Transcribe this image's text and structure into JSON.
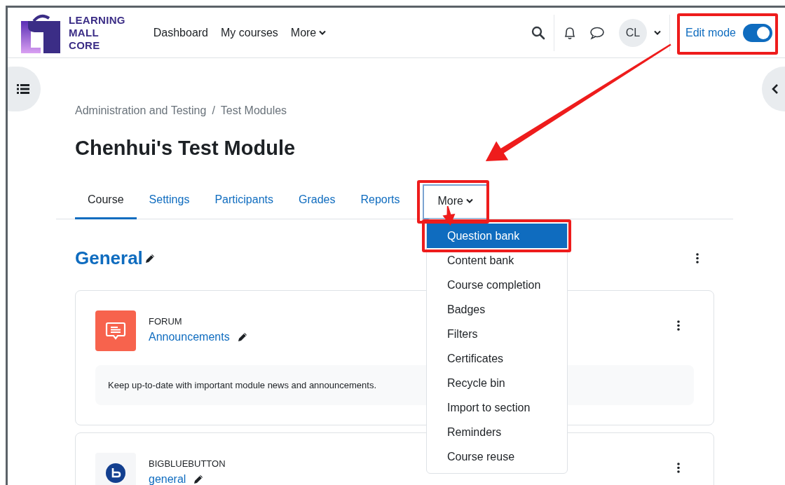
{
  "header": {
    "logo_lines": [
      "LEARNING",
      "MALL",
      "CORE"
    ],
    "nav": [
      {
        "label": "Dashboard",
        "kind": "link"
      },
      {
        "label": "My courses",
        "kind": "link"
      },
      {
        "label": "More",
        "kind": "dropdown"
      }
    ],
    "avatar": "CL",
    "edit_mode": {
      "label": "Edit mode",
      "on": true
    }
  },
  "breadcrumb": {
    "items": [
      "Administration and Testing",
      "Test Modules"
    ],
    "separator": "/"
  },
  "title": "Chenhui's Test Module",
  "tabs": [
    {
      "label": "Course",
      "selected": true,
      "kind": "link"
    },
    {
      "label": "Settings",
      "selected": false,
      "kind": "link"
    },
    {
      "label": "Participants",
      "selected": false,
      "kind": "link"
    },
    {
      "label": "Grades",
      "selected": false,
      "kind": "link"
    },
    {
      "label": "Reports",
      "selected": false,
      "kind": "link"
    },
    {
      "label": "More",
      "selected": false,
      "kind": "dropdown",
      "expanded": true
    }
  ],
  "more_menu": [
    {
      "label": "Question bank",
      "selected": true
    },
    {
      "label": "Content bank",
      "selected": false
    },
    {
      "label": "Course completion",
      "selected": false
    },
    {
      "label": "Badges",
      "selected": false
    },
    {
      "label": "Filters",
      "selected": false
    },
    {
      "label": "Certificates",
      "selected": false
    },
    {
      "label": "Recycle bin",
      "selected": false
    },
    {
      "label": "Import to section",
      "selected": false
    },
    {
      "label": "Reminders",
      "selected": false
    },
    {
      "label": "Course reuse",
      "selected": false
    }
  ],
  "section": {
    "title": "General"
  },
  "activities": [
    {
      "kind": "forum",
      "type_label": "FORUM",
      "name": "Announcements",
      "description": "Keep up-to-date with important module news and announcements."
    },
    {
      "kind": "bigbluebutton",
      "type_label": "BIGBLUEBUTTON",
      "name": "general"
    }
  ],
  "annotations": [
    {
      "kind": "box"
    },
    {
      "kind": "box"
    },
    {
      "kind": "box"
    },
    {
      "kind": "arrow"
    },
    {
      "kind": "arrow"
    }
  ]
}
